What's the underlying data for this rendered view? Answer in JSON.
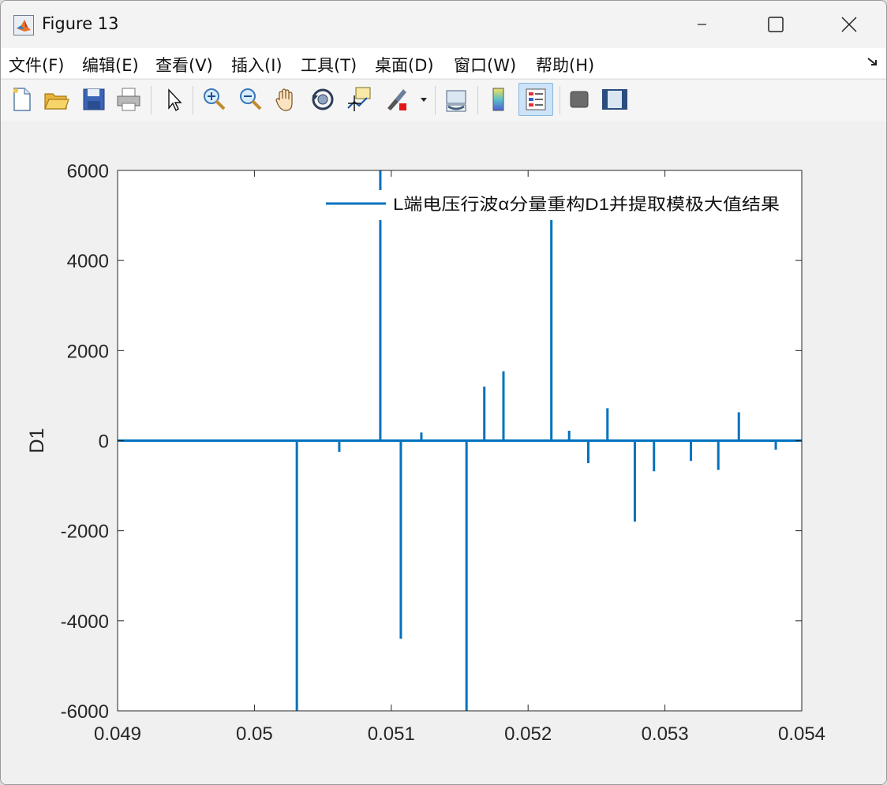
{
  "window": {
    "title": "Figure 13",
    "controls": [
      "minimize",
      "maximize",
      "close"
    ]
  },
  "menubar": {
    "items": [
      {
        "label": "文件(F)",
        "name": "file"
      },
      {
        "label": "编辑(E)",
        "name": "edit"
      },
      {
        "label": "查看(V)",
        "name": "view"
      },
      {
        "label": "插入(I)",
        "name": "insert"
      },
      {
        "label": "工具(T)",
        "name": "tools"
      },
      {
        "label": "桌面(D)",
        "name": "desktop"
      },
      {
        "label": "窗口(W)",
        "name": "window"
      },
      {
        "label": "帮助(H)",
        "name": "help"
      }
    ]
  },
  "toolbar": {
    "buttons": [
      "new-figure-icon",
      "open-icon",
      "save-icon",
      "print-icon",
      "edit-plot-arrow-icon",
      "zoom-in-icon",
      "zoom-out-icon",
      "pan-hand-icon",
      "rotate-3d-icon",
      "data-cursor-icon",
      "brush-icon",
      "link-plot-icon",
      "colorbar-icon",
      "legend-icon",
      "hide-plot-tools-icon",
      "show-plot-tools-icon"
    ],
    "active": "legend-icon"
  },
  "colors": {
    "series": "#0072BD",
    "axes": "#262626",
    "figure_bg": "#f0f0f0",
    "plot_bg": "#ffffff"
  },
  "chart_data": {
    "type": "line",
    "title": "",
    "xlabel": "",
    "ylabel": "D1",
    "xlim": [
      0.049,
      0.054
    ],
    "ylim": [
      -6000,
      6000
    ],
    "xticks": [
      0.049,
      0.05,
      0.051,
      0.052,
      0.053,
      0.054
    ],
    "xtick_labels": [
      "0.049",
      "0.05",
      "0.051",
      "0.052",
      "0.053",
      "0.054"
    ],
    "yticks": [
      -6000,
      -4000,
      -2000,
      0,
      2000,
      4000,
      6000
    ],
    "ytick_labels": [
      "-6000",
      "-4000",
      "-2000",
      "0",
      "2000",
      "4000",
      "6000"
    ],
    "grid": false,
    "legend": {
      "position": "top-right",
      "entries": [
        "L端电压行波α分量重构D1并提取模极大值结果"
      ]
    },
    "series": [
      {
        "name": "L端电压行波α分量重构D1并提取模极大值结果",
        "baseline": 0,
        "spikes": [
          {
            "x": 0.05031,
            "y": -6000
          },
          {
            "x": 0.05062,
            "y": -250
          },
          {
            "x": 0.05092,
            "y": 6000
          },
          {
            "x": 0.05107,
            "y": -4400
          },
          {
            "x": 0.05122,
            "y": 180
          },
          {
            "x": 0.05155,
            "y": -6000
          },
          {
            "x": 0.05168,
            "y": 1200
          },
          {
            "x": 0.05182,
            "y": 1540
          },
          {
            "x": 0.05217,
            "y": 4900
          },
          {
            "x": 0.0523,
            "y": 220
          },
          {
            "x": 0.05244,
            "y": -500
          },
          {
            "x": 0.05258,
            "y": 720
          },
          {
            "x": 0.05278,
            "y": -1800
          },
          {
            "x": 0.05292,
            "y": -680
          },
          {
            "x": 0.05319,
            "y": -450
          },
          {
            "x": 0.05339,
            "y": -650
          },
          {
            "x": 0.05354,
            "y": 630
          },
          {
            "x": 0.05381,
            "y": -200
          }
        ]
      }
    ]
  }
}
